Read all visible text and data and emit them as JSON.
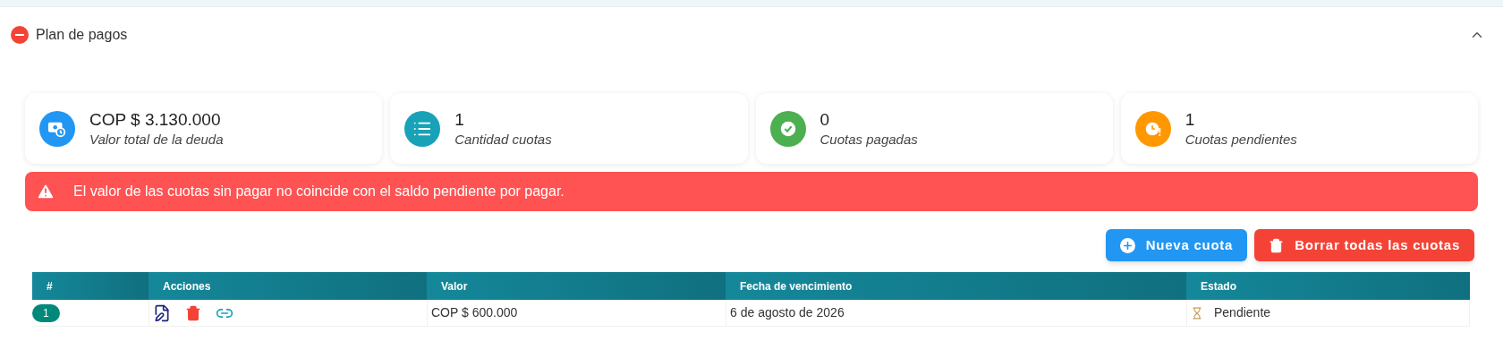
{
  "panel": {
    "title": "Plan de pagos",
    "expanded": true
  },
  "stats": [
    {
      "kind": "money",
      "color": "#2196f3",
      "value": "COP $ 3.130.000",
      "label": "Valor total de la deuda"
    },
    {
      "kind": "list",
      "color": "#17a2b8",
      "value": "1",
      "label": "Cantidad cuotas"
    },
    {
      "kind": "check",
      "color": "#4caf50",
      "value": "0",
      "label": "Cuotas pagadas"
    },
    {
      "kind": "clock",
      "color": "#ff9800",
      "value": "1",
      "label": "Cuotas pendientes"
    }
  ],
  "alert": {
    "message": "El valor de las cuotas sin pagar no coincide con el saldo pendiente por pagar."
  },
  "buttons": [
    {
      "kind": "add",
      "label": "Nueva cuota"
    },
    {
      "kind": "delete",
      "label": "Borrar todas las cuotas"
    }
  ],
  "table": {
    "columns": [
      "#",
      "Acciones",
      "Valor",
      "Fecha de vencimiento",
      "Estado"
    ],
    "rows": [
      {
        "index": "1",
        "value": "COP $ 600.000",
        "due_date": "6 de agosto de 2026",
        "status": "Pendiente"
      }
    ]
  }
}
